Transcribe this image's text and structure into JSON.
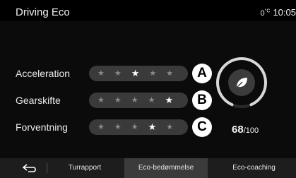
{
  "header": {
    "title": "Driving Eco",
    "temperature": "0",
    "temp_unit": "°C",
    "time": "10:05"
  },
  "ratings": [
    {
      "label": "Acceleration",
      "marker": "A",
      "stars": 3,
      "max": 5
    },
    {
      "label": "Gearskifte",
      "marker": "B",
      "stars": 5,
      "max": 5
    },
    {
      "label": "Forventning",
      "marker": "C",
      "stars": 4,
      "max": 5
    }
  ],
  "score": {
    "value": "68",
    "total": "/100",
    "icon": "leaf-icon"
  },
  "nav": {
    "back_icon": "back-arrow-icon",
    "tabs": [
      "Turrapport",
      "Eco-bedømmelse",
      "Eco-coaching"
    ],
    "selected": "Eco-bedømmelse"
  }
}
